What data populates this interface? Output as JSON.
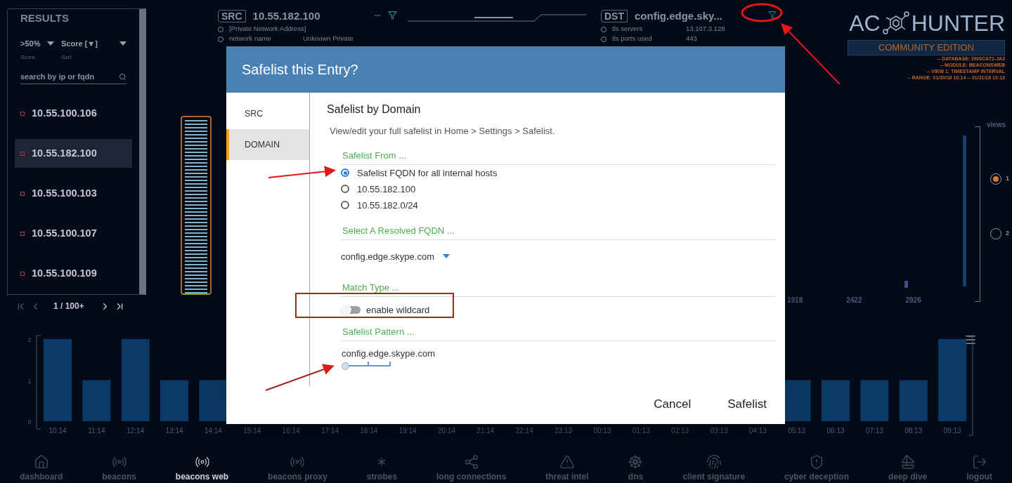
{
  "results_panel": {
    "title": "RESULTS",
    "filters": [
      {
        "value": ">50%",
        "label": "Score"
      },
      {
        "value": "Score [▼]",
        "label": "Sort"
      }
    ],
    "search": {
      "placeholder": "search by ip or fqdn"
    },
    "items": [
      {
        "ip": "10.55.100.106",
        "selected": false
      },
      {
        "ip": "10.55.182.100",
        "selected": true
      },
      {
        "ip": "10.55.100.103",
        "selected": false
      },
      {
        "ip": "10.55.100.107",
        "selected": false
      },
      {
        "ip": "10.55.100.109",
        "selected": false
      }
    ],
    "pager": "1 / 100+"
  },
  "src": {
    "tag": "SRC",
    "address": "10.55.182.100",
    "rows": [
      {
        "label": "[Private Network Address]"
      },
      {
        "label": "network name",
        "value": "Unknown Private"
      }
    ]
  },
  "dst": {
    "tag": "DST",
    "name": "config.edge.sky...",
    "rows": [
      {
        "label": "tls servers",
        "value": "13.107.3.128"
      },
      {
        "label": "tls ports used",
        "value": "443"
      }
    ]
  },
  "brand": {
    "name_left": "AC",
    "name_right": "HUNTER",
    "edition": "COMMUNITY EDITION",
    "info": [
      "-- DATABASE: DNSCAT2-JA3",
      "-- MODULE: BEACONSWEB",
      "-- VIEW 1: TIMESTAMP INTERVAL",
      "-- RANGE: 01/30/18 10:14 -- 01/31/18 10:13"
    ]
  },
  "upper_axis_labels": [
    "1918",
    "2422",
    "2926"
  ],
  "views": {
    "title": "views",
    "items": [
      {
        "label": "1",
        "selected": true
      },
      {
        "label": "2",
        "selected": false
      }
    ]
  },
  "timeline": {
    "chart_data": {
      "type": "bar",
      "categories": [
        "10:14",
        "11:14",
        "12:14",
        "13:14",
        "14:14",
        "15:14",
        "16:14",
        "17:14",
        "18:14",
        "19:14",
        "20:14",
        "21:14",
        "22:14",
        "23:13",
        "00:13",
        "01:13",
        "02:13",
        "03:13",
        "04:13",
        "05:13",
        "06:13",
        "07:13",
        "08:13",
        "09:13"
      ],
      "values": [
        2,
        1,
        2,
        1,
        1,
        null,
        null,
        null,
        null,
        null,
        null,
        null,
        null,
        null,
        null,
        null,
        null,
        null,
        null,
        1,
        1,
        1,
        1,
        2
      ],
      "yticks": [
        0,
        1,
        2
      ],
      "ylim": [
        0,
        2
      ]
    }
  },
  "nav": [
    {
      "label": "dashboard",
      "selected": false
    },
    {
      "label": "beacons",
      "selected": false
    },
    {
      "label": "beacons web",
      "selected": true
    },
    {
      "label": "beacons proxy",
      "selected": false
    },
    {
      "label": "strobes",
      "selected": false
    },
    {
      "label": "long connections",
      "selected": false
    },
    {
      "label": "threat intel",
      "selected": false
    },
    {
      "label": "dns",
      "selected": false
    },
    {
      "label": "client signature",
      "selected": false
    },
    {
      "label": "cyber deception",
      "selected": false
    },
    {
      "label": "deep dive",
      "selected": false
    },
    {
      "label": "logout",
      "selected": false
    }
  ],
  "dialog": {
    "title": "Safelist this Entry?",
    "tabs": [
      {
        "label": "SRC",
        "selected": false
      },
      {
        "label": "DOMAIN",
        "selected": true
      }
    ],
    "heading": "Safelist by Domain",
    "note": "View/edit your full safelist in Home > Settings > Safelist.",
    "sections": [
      {
        "kind": "radios",
        "label": "Safelist From ...",
        "options": [
          {
            "label": "Safelist FQDN for all internal hosts",
            "selected": true
          },
          {
            "label": "10.55.182.100",
            "selected": false
          },
          {
            "label": "10.55.182.0/24",
            "selected": false
          }
        ]
      },
      {
        "kind": "select",
        "label": "Select A Resolved FQDN ...",
        "value": "config.edge.skype.com"
      },
      {
        "kind": "toggle",
        "label": "Match Type ...",
        "toggle": {
          "label": "enable wildcard",
          "on": false
        }
      },
      {
        "kind": "pattern",
        "label": "Safelist Pattern ...",
        "value": "config.edge.skype.com",
        "slider": {
          "level": 0
        }
      }
    ],
    "buttons": [
      "Cancel",
      "Safelist"
    ]
  }
}
